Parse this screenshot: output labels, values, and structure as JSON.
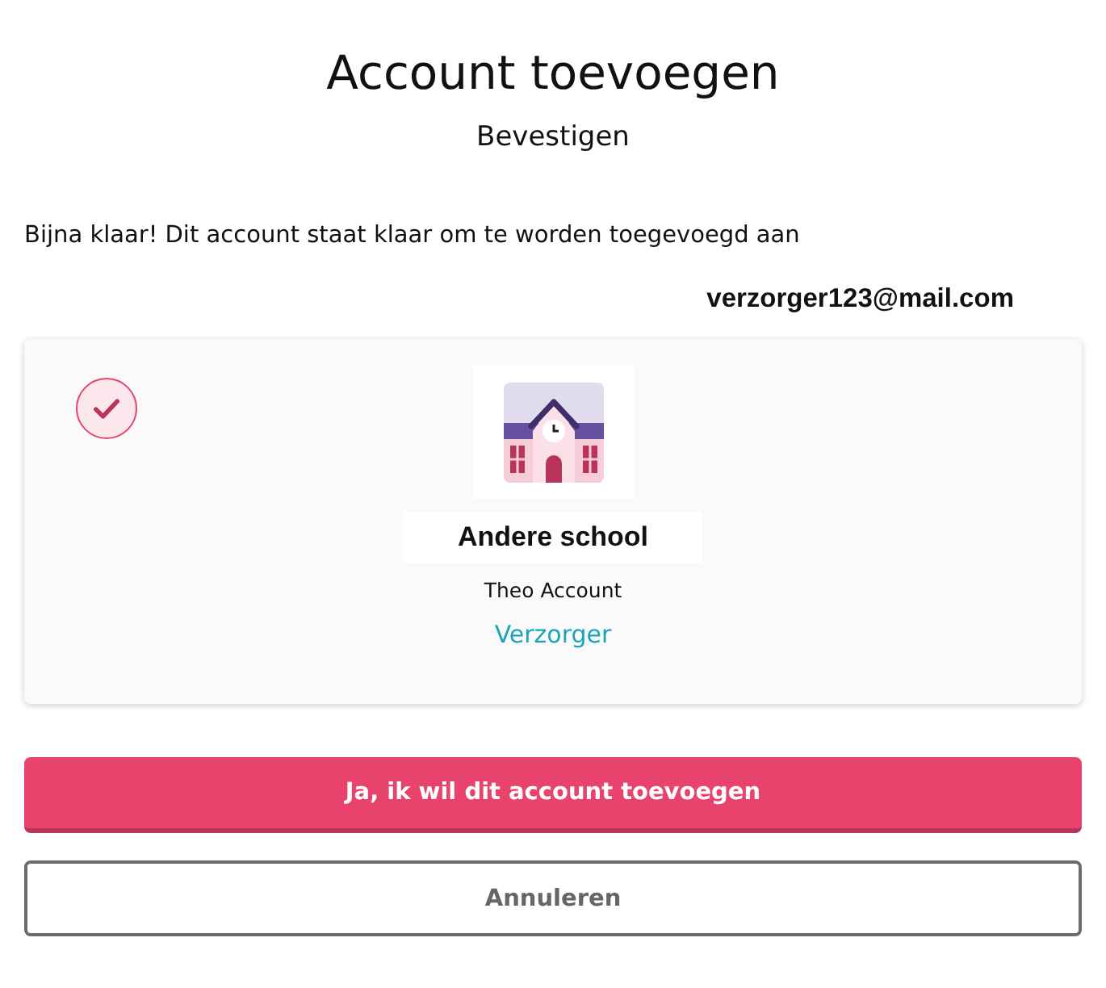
{
  "title": "Account toevoegen",
  "subtitle": "Bevestigen",
  "message": "Bijna klaar! Dit account staat klaar om te worden toegevoegd aan",
  "email": "verzorger123@mail.com",
  "account": {
    "checked": true,
    "school": "Andere school",
    "name": "Theo Account",
    "role": "Verzorger"
  },
  "buttons": [
    {
      "label": "Ja, ik wil dit account toevoegen",
      "kind": "primary"
    },
    {
      "label": "Annuleren",
      "kind": "secondary"
    }
  ]
}
